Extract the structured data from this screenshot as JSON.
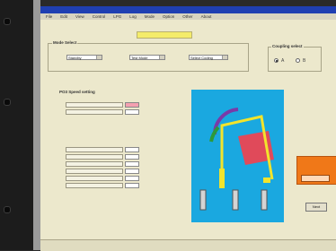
{
  "window": {
    "title": "",
    "menu": [
      "File",
      "Edit",
      "View",
      "Control",
      "LPG",
      "Log",
      "Mode",
      "Option",
      "Other",
      "About"
    ]
  },
  "ready_badge": "",
  "mode_select": {
    "title": "Mode Select",
    "fields": [
      {
        "label": "",
        "value": "Standby"
      },
      {
        "label": "",
        "value": "Test Mode"
      },
      {
        "label": "",
        "value": "Select Coding"
      }
    ]
  },
  "coupling": {
    "title": "Coupling select",
    "options": [
      {
        "label": "A",
        "selected": true
      },
      {
        "label": "B",
        "selected": false
      }
    ]
  },
  "speed_setting": {
    "title": "PO3 Speed setting",
    "rows": [
      {
        "label": "",
        "value": "",
        "highlight": true
      },
      {
        "label": "",
        "value": ""
      }
    ]
  },
  "position_setting": {
    "rows": [
      {
        "label": "",
        "value": ""
      },
      {
        "label": "",
        "value": ""
      },
      {
        "label": "",
        "value": ""
      },
      {
        "label": "",
        "value": ""
      },
      {
        "label": "",
        "value": ""
      },
      {
        "label": "",
        "value": ""
      }
    ]
  },
  "alert_box": {
    "text": "",
    "color": "#f07818"
  },
  "next_button": "Next",
  "colors": {
    "titlebar": "#1f3fb2",
    "panel": "#1aa8e0",
    "arm": "#f2e42c",
    "vessel": "#e04a5a",
    "alert": "#f07818"
  }
}
